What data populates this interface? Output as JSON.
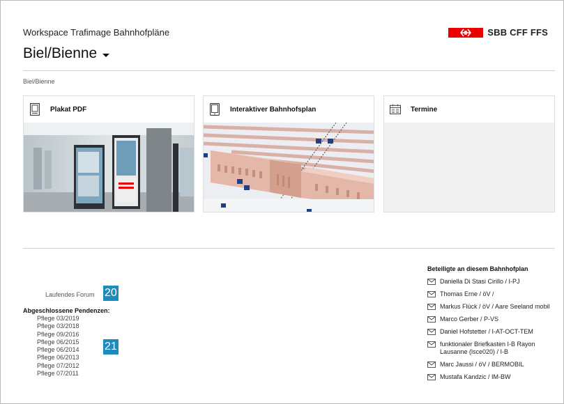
{
  "header": {
    "workspace_title": "Workspace Trafimage Bahnhofpläne",
    "station": "Biel/Bienne",
    "logo_text": "SBB CFF FFS"
  },
  "breadcrumb": "Biel/Bienne",
  "cards": [
    {
      "label": "Plakat PDF",
      "icon": "poster-icon"
    },
    {
      "label": "Interaktiver Bahnhofsplan",
      "icon": "tablet-icon"
    },
    {
      "label": "Termine",
      "icon": "calendar-icon"
    }
  ],
  "forum": {
    "label": "Laufendes Forum",
    "badge": "20"
  },
  "closed": {
    "title": "Abgeschlossene Pendenzen:",
    "badge": "21",
    "items": [
      "Pflege 03/2019",
      "Pflege 03/2018",
      "Pflege 09/2016",
      "Pflege 06/2015",
      "Pflege 06/2014",
      "Pflege 06/2013",
      "Pflege 07/2012",
      "Pflege 07/2011"
    ]
  },
  "participants": {
    "title": "Beteiligte an diesem Bahnhofplan",
    "items": [
      "Daniella Di Stasi Cirillo / I-PJ",
      "Thomas Erne / öV /",
      "Markus Flück / öV / Aare Seeland mobil",
      "Marco Gerber / P-VS",
      "Daniel Hofstetter / I-AT-OCT-TEM",
      "funktionaler Briefkasten I-B Rayon Lausanne (lsce020) / I-B",
      "Marc Jaussi / öV / BERMOBIL",
      "Mustafa Kandzic / IM-BW"
    ]
  },
  "colors": {
    "brand_red": "#eb0000",
    "badge_blue": "#1d8bbc"
  }
}
